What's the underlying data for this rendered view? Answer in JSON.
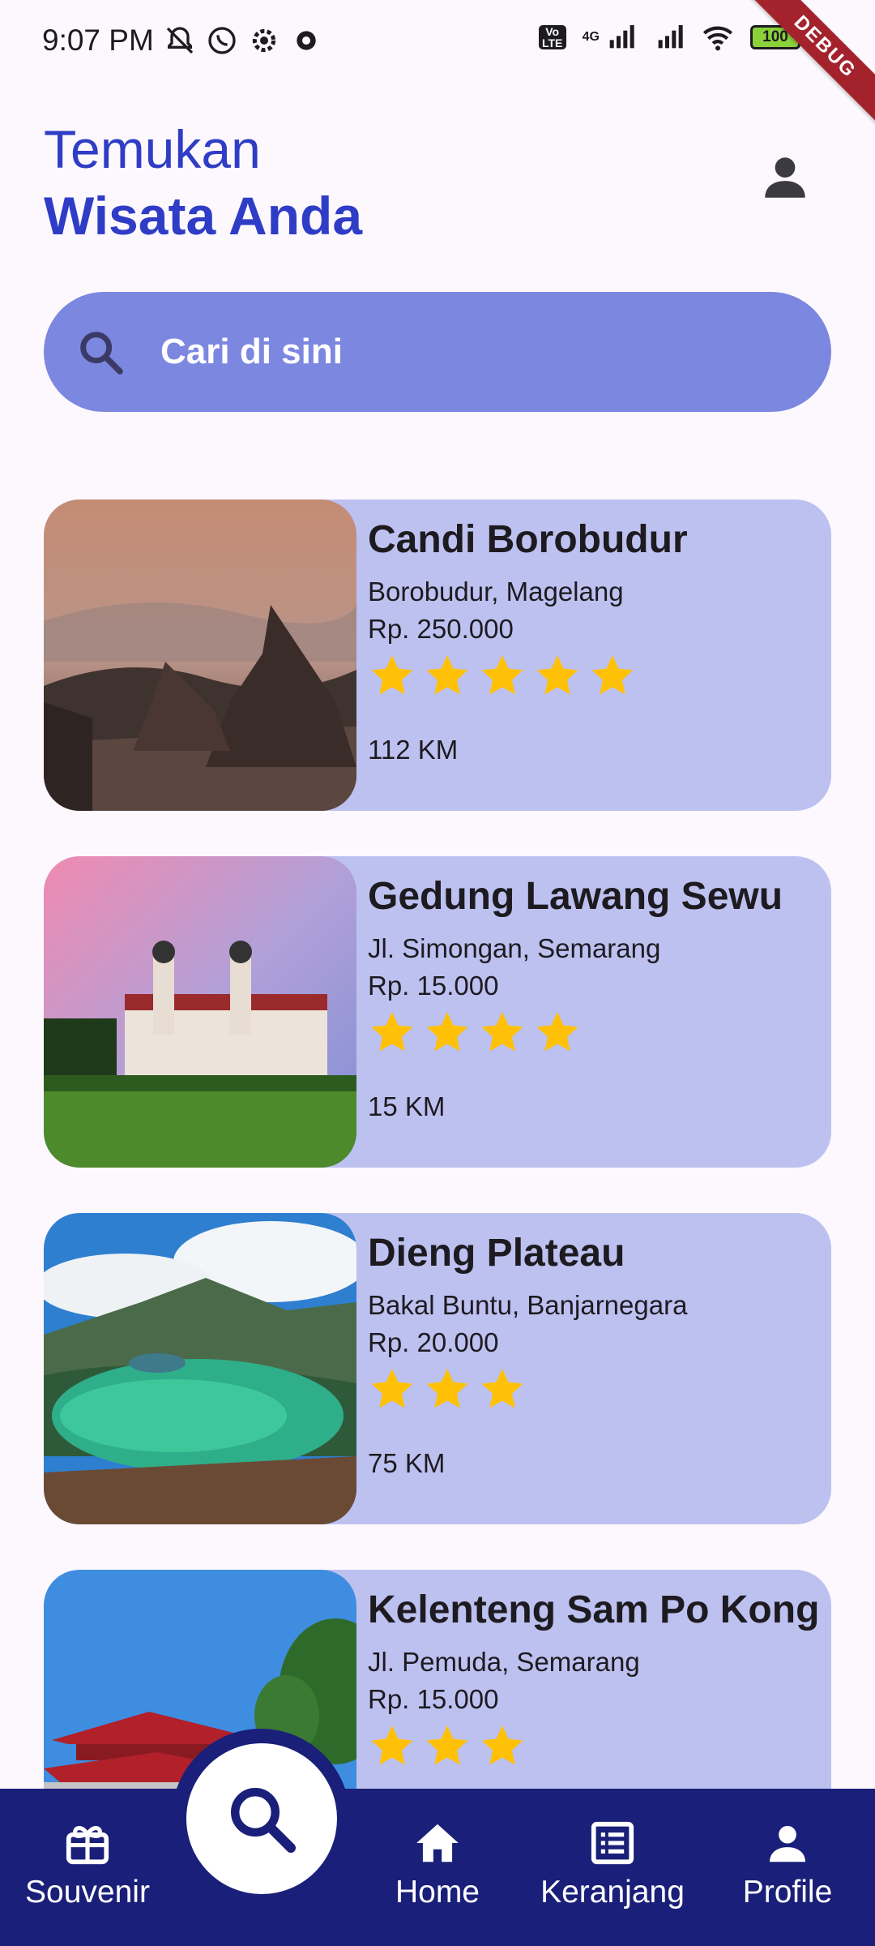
{
  "status_bar": {
    "time": "9:07 PM",
    "network": "4G",
    "battery": "100",
    "debug_banner": "DEBUG"
  },
  "header": {
    "title_line1": "Temukan",
    "title_line2": "Wisata Anda"
  },
  "search": {
    "placeholder": "Cari di sini"
  },
  "destinations": [
    {
      "name": "Candi Borobudur",
      "location": "Borobudur, Magelang",
      "price": "Rp. 250.000",
      "rating": 5,
      "distance": "112 KM"
    },
    {
      "name": "Gedung Lawang Sewu",
      "location": "Jl. Simongan, Semarang",
      "price": "Rp. 15.000",
      "rating": 4,
      "distance": "15 KM"
    },
    {
      "name": "Dieng Plateau",
      "location": "Bakal Buntu, Banjarnegara",
      "price": "Rp. 20.000",
      "rating": 3,
      "distance": "75 KM"
    },
    {
      "name": "Kelenteng Sam Po Kong",
      "location": "Jl. Pemuda, Semarang",
      "price": "Rp. 15.000",
      "rating": 3,
      "distance": ""
    }
  ],
  "bottom_nav": {
    "items": [
      {
        "label": "Souvenir",
        "icon": "gift-icon"
      },
      {
        "label": "Home",
        "icon": "home-icon"
      },
      {
        "label": "Keranjang",
        "icon": "list-icon"
      },
      {
        "label": "Profile",
        "icon": "person-icon"
      }
    ],
    "fab_icon": "search-icon"
  },
  "colors": {
    "accent": "#2f3dc6",
    "search_bg": "#7c87e0",
    "card_bg": "#bdc1f0",
    "nav_bg": "#1a1f79",
    "star": "#ffc107"
  }
}
